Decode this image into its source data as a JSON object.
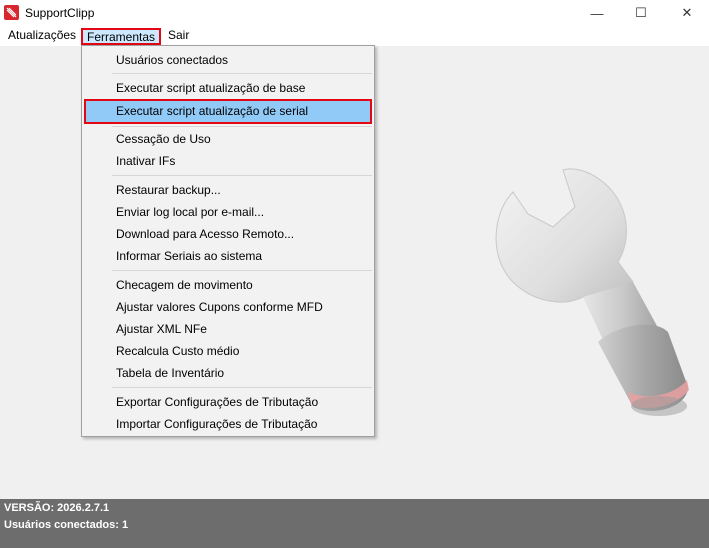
{
  "window": {
    "title": "SupportClipp",
    "minimize_glyph": "—",
    "maximize_glyph": "☐",
    "close_glyph": "✕"
  },
  "menubar": {
    "items": [
      "Atualizações",
      "Ferramentas",
      "Sair"
    ]
  },
  "dropdown": {
    "items": [
      "Usuários conectados",
      "Executar script atualização de base",
      "Executar script atualização de serial",
      "Cessação de Uso",
      "Inativar IFs",
      "Restaurar backup...",
      "Enviar log local por e-mail...",
      "Download para Acesso Remoto...",
      "Informar Seriais ao sistema",
      "Checagem de movimento",
      "Ajustar valores Cupons conforme MFD",
      "Ajustar XML NFe",
      "Recalcula Custo médio",
      "Tabela de Inventário",
      "Exportar Configurações de Tributação",
      "Importar Configurações de Tributação"
    ],
    "highlighted_item": "Executar script atualização de serial"
  },
  "status": {
    "version": "VERSÃO: 2026.2.7.1",
    "users": "Usuários conectados: 1"
  },
  "colors": {
    "accent_red": "#e30613",
    "highlight_blue": "#91c9f7",
    "statusbar": "#6d6d6d"
  },
  "icons": {
    "app": "app-logo-icon",
    "background": "wrench-icon"
  }
}
